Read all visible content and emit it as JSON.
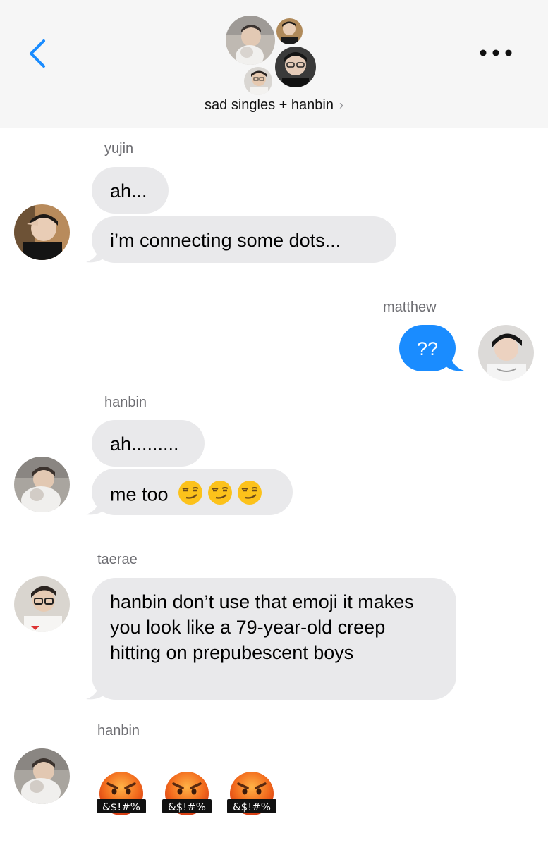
{
  "header": {
    "group_name": "sad singles + hanbin",
    "chevron": "›",
    "back_icon": "chevron-left-icon",
    "more_icon": "ellipsis-icon",
    "accent": "#1a8cff"
  },
  "messages": [
    {
      "sender": "yujin",
      "bubbles": [
        "ah...",
        "i’m connecting some dots..."
      ]
    },
    {
      "sender": "matthew",
      "bubbles": [
        "??"
      ],
      "outgoing": true
    },
    {
      "sender": "hanbin",
      "bubbles": [
        "ah.........",
        "me too"
      ],
      "emoji": [
        "smirk",
        "smirk",
        "smirk"
      ]
    },
    {
      "sender": "taerae",
      "bubbles": [
        "hanbin don’t use that emoji it makes you look like a 79-year-old creep hitting on prepubescent boys"
      ]
    },
    {
      "sender": "hanbin",
      "emoji_only": [
        "face-with-symbols-on-mouth",
        "face-with-symbols-on-mouth",
        "face-with-symbols-on-mouth"
      ],
      "censor_text": "&$!#%"
    }
  ]
}
